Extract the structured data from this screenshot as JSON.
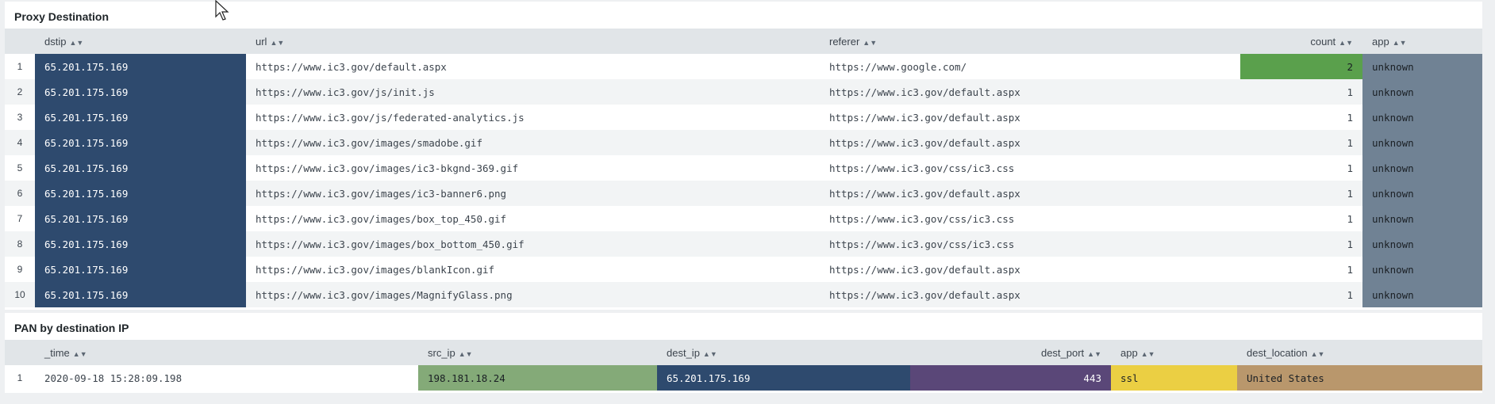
{
  "proxy_panel": {
    "title": "Proxy Destination",
    "columns": [
      {
        "label": "dstip"
      },
      {
        "label": "url"
      },
      {
        "label": "referer"
      },
      {
        "label": "count"
      },
      {
        "label": "app"
      }
    ],
    "rows": [
      {
        "num": "1",
        "dstip": "65.201.175.169",
        "url": "https://www.ic3.gov/default.aspx",
        "referer": "https://www.google.com/",
        "count": "2",
        "app": "unknown"
      },
      {
        "num": "2",
        "dstip": "65.201.175.169",
        "url": "https://www.ic3.gov/js/init.js",
        "referer": "https://www.ic3.gov/default.aspx",
        "count": "1",
        "app": "unknown"
      },
      {
        "num": "3",
        "dstip": "65.201.175.169",
        "url": "https://www.ic3.gov/js/federated-analytics.js",
        "referer": "https://www.ic3.gov/default.aspx",
        "count": "1",
        "app": "unknown"
      },
      {
        "num": "4",
        "dstip": "65.201.175.169",
        "url": "https://www.ic3.gov/images/smadobe.gif",
        "referer": "https://www.ic3.gov/default.aspx",
        "count": "1",
        "app": "unknown"
      },
      {
        "num": "5",
        "dstip": "65.201.175.169",
        "url": "https://www.ic3.gov/images/ic3-bkgnd-369.gif",
        "referer": "https://www.ic3.gov/css/ic3.css",
        "count": "1",
        "app": "unknown"
      },
      {
        "num": "6",
        "dstip": "65.201.175.169",
        "url": "https://www.ic3.gov/images/ic3-banner6.png",
        "referer": "https://www.ic3.gov/default.aspx",
        "count": "1",
        "app": "unknown"
      },
      {
        "num": "7",
        "dstip": "65.201.175.169",
        "url": "https://www.ic3.gov/images/box_top_450.gif",
        "referer": "https://www.ic3.gov/css/ic3.css",
        "count": "1",
        "app": "unknown"
      },
      {
        "num": "8",
        "dstip": "65.201.175.169",
        "url": "https://www.ic3.gov/images/box_bottom_450.gif",
        "referer": "https://www.ic3.gov/css/ic3.css",
        "count": "1",
        "app": "unknown"
      },
      {
        "num": "9",
        "dstip": "65.201.175.169",
        "url": "https://www.ic3.gov/images/blankIcon.gif",
        "referer": "https://www.ic3.gov/default.aspx",
        "count": "1",
        "app": "unknown"
      },
      {
        "num": "10",
        "dstip": "65.201.175.169",
        "url": "https://www.ic3.gov/images/MagnifyGlass.png",
        "referer": "https://www.ic3.gov/default.aspx",
        "count": "1",
        "app": "unknown"
      }
    ]
  },
  "pan_panel": {
    "title": "PAN by destination IP",
    "columns": [
      {
        "label": "_time"
      },
      {
        "label": "src_ip"
      },
      {
        "label": "dest_ip"
      },
      {
        "label": "dest_port"
      },
      {
        "label": "app"
      },
      {
        "label": "dest_location"
      }
    ],
    "rows": [
      {
        "num": "1",
        "time": "2020-09-18 15:28:09.198",
        "src_ip": "198.181.18.24",
        "dest_ip": "65.201.175.169",
        "dest_port": "443",
        "app": "ssl",
        "dest_location": "United States"
      }
    ]
  },
  "colors": {
    "dstip_cell": "#2e4a6e",
    "app_cell": "#708294",
    "count_high": "#5aa04c",
    "src_ip_cell": "#84aa78",
    "dest_port_cell": "#5a4778",
    "app_ssl_cell": "#ebcf43",
    "location_cell": "#b9976c"
  },
  "icons": {
    "sort": "sort-icon",
    "cursor": "mouse-pointer-icon"
  }
}
